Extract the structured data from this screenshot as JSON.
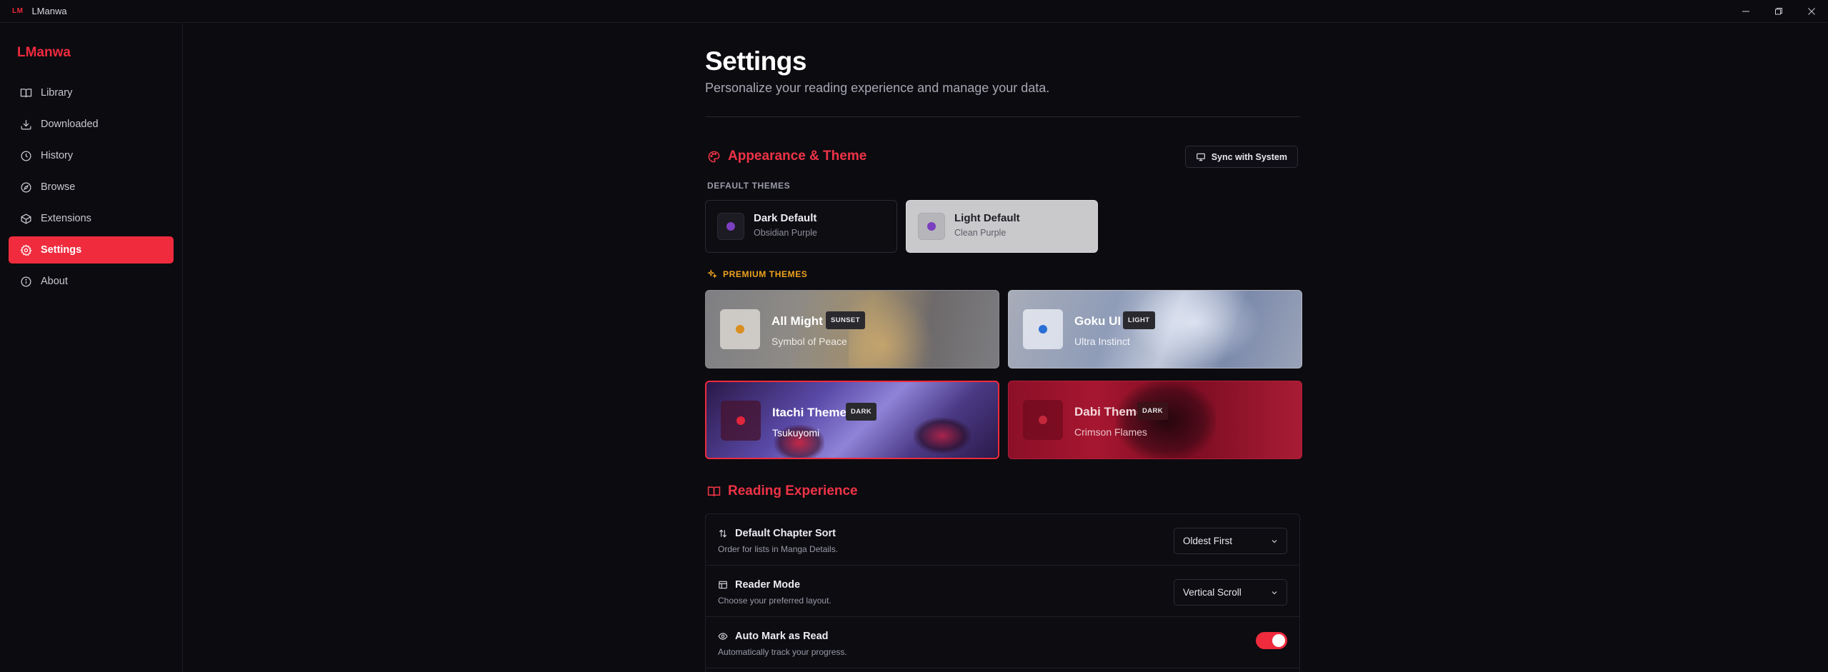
{
  "titlebar": {
    "logo": "LM",
    "title": "LManwa"
  },
  "sidebar": {
    "brand": "LManwa",
    "items": [
      {
        "label": "Library",
        "icon": "book-icon"
      },
      {
        "label": "Downloaded",
        "icon": "download-icon"
      },
      {
        "label": "History",
        "icon": "clock-icon"
      },
      {
        "label": "Browse",
        "icon": "compass-icon"
      },
      {
        "label": "Extensions",
        "icon": "package-icon"
      },
      {
        "label": "Settings",
        "icon": "gear-icon",
        "active": true
      },
      {
        "label": "About",
        "icon": "info-icon"
      }
    ]
  },
  "page": {
    "title": "Settings",
    "subtitle": "Personalize your reading experience and manage your data."
  },
  "appearance": {
    "heading": "Appearance & Theme",
    "sync_label": "Sync with System",
    "default_heading": "DEFAULT THEMES",
    "premium_heading": "PREMIUM THEMES",
    "default_themes": [
      {
        "name": "Dark Default",
        "desc": "Obsidian Purple",
        "dot": "#7b3fbf"
      },
      {
        "name": "Light Default",
        "desc": "Clean Purple",
        "dot": "#7b3fbf"
      }
    ],
    "premium_themes": [
      {
        "name": "All Might",
        "badge": "SUNSET",
        "desc": "Symbol of Peace",
        "dot": "#d98e1f"
      },
      {
        "name": "Goku UI",
        "badge": "LIGHT",
        "desc": "Ultra Instinct",
        "dot": "#2a6fd6"
      },
      {
        "name": "Itachi Theme",
        "badge": "DARK",
        "desc": "Tsukuyomi",
        "dot": "#e2263b",
        "selected": true
      },
      {
        "name": "Dabi Theme",
        "badge": "DARK",
        "desc": "Crimson Flames",
        "dot": "#c4283a"
      }
    ]
  },
  "reading": {
    "heading": "Reading Experience",
    "rows": [
      {
        "label": "Default Chapter Sort",
        "hint": "Order for lists in Manga Details.",
        "value": "Oldest First",
        "icon": "sort-icon"
      },
      {
        "label": "Reader Mode",
        "hint": "Choose your preferred layout.",
        "value": "Vertical Scroll",
        "icon": "layout-icon"
      },
      {
        "label": "Auto Mark as Read",
        "hint": "Automatically track your progress.",
        "toggle": true,
        "icon": "eye-icon"
      }
    ]
  },
  "colors": {
    "accent": "#ef2b3d",
    "premium": "#f0a31e",
    "background": "#0b0b10"
  }
}
